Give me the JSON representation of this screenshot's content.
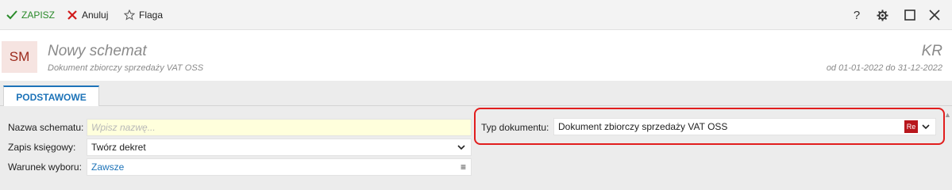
{
  "toolbar": {
    "save_label": "ZAPISZ",
    "cancel_label": "Anuluj",
    "flag_label": "Flaga",
    "icons": [
      "check-icon",
      "x-icon",
      "star-icon",
      "help-icon",
      "gear-icon",
      "maximize-icon",
      "close-icon"
    ]
  },
  "window_controls": {
    "help": "?"
  },
  "header": {
    "avatar_initials": "SM",
    "title": "Nowy schemat",
    "subtitle": "Dokument zbiorczy sprzedaży VAT OSS",
    "code": "KR",
    "period": "od 01-01-2022 do 31-12-2022"
  },
  "tabs": [
    {
      "label": "PODSTAWOWE",
      "active": true
    }
  ],
  "form": {
    "name": {
      "label": "Nazwa schematu:",
      "placeholder": "Wpisz nazwę...",
      "value": ""
    },
    "zapis": {
      "label": "Zapis księgowy:",
      "value": "Twórz dekret"
    },
    "warunek": {
      "label": "Warunek wyboru:",
      "value": "Zawsze"
    },
    "typ": {
      "label": "Typ dokumentu:",
      "value": "Dokument zbiorczy sprzedaży VAT OSS",
      "badge": "Re"
    }
  },
  "colors": {
    "accent": "#1d73b8",
    "save_green": "#2a8a2a",
    "cancel_red": "#d11a1a",
    "highlight": "#e11d1d",
    "avatar_text": "#9c2a1c",
    "avatar_bg": "#f6e4e1",
    "name_field_bg": "#ffffdc"
  }
}
